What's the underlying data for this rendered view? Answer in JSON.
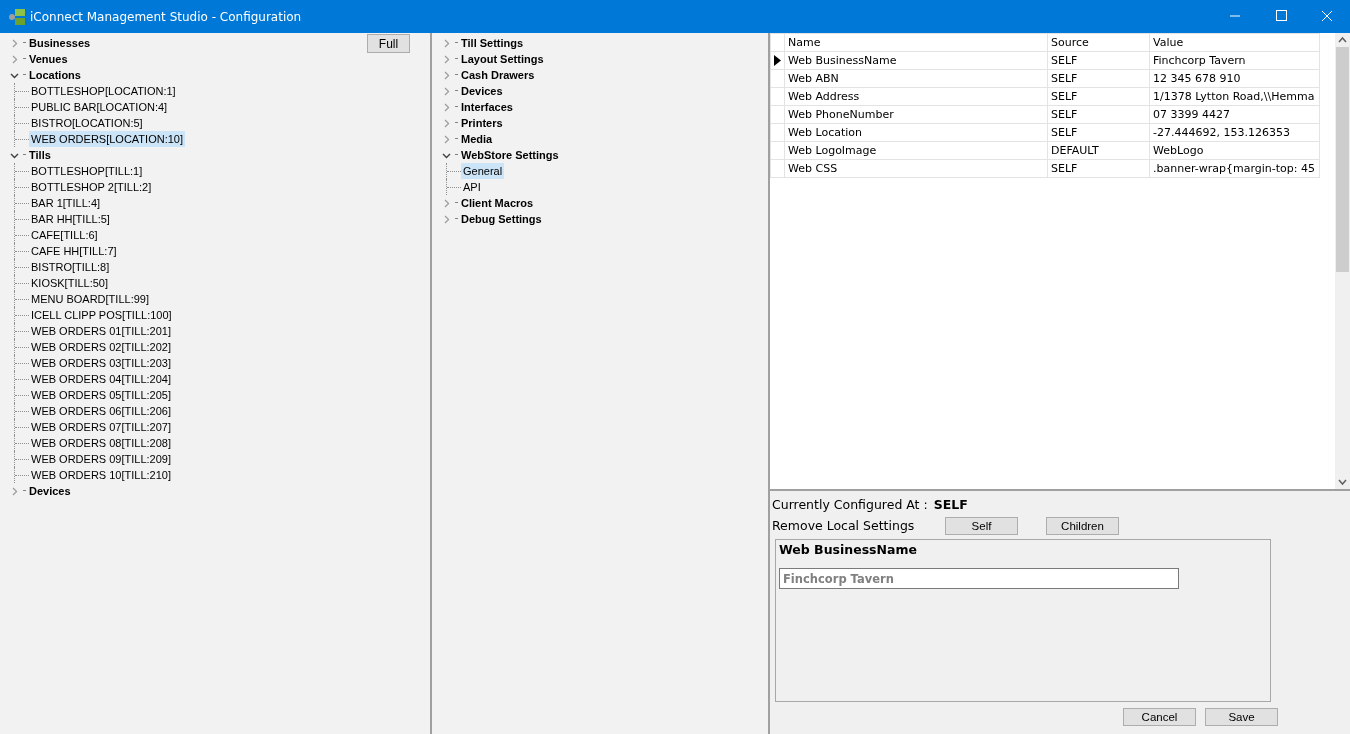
{
  "window": {
    "title": "iConnect Management Studio - Configuration"
  },
  "entity_tree": {
    "full_button": "Full",
    "items": [
      {
        "label": "Businesses",
        "expanded": false
      },
      {
        "label": "Venues",
        "expanded": false
      },
      {
        "label": "Locations",
        "expanded": true,
        "children": [
          {
            "label": "BOTTLESHOP[LOCATION:1]",
            "selected": false
          },
          {
            "label": "PUBLIC BAR[LOCATION:4]",
            "selected": false
          },
          {
            "label": "BISTRO[LOCATION:5]",
            "selected": false
          },
          {
            "label": "WEB ORDERS[LOCATION:10]",
            "selected": true
          }
        ]
      },
      {
        "label": "Tills",
        "expanded": true,
        "children": [
          {
            "label": "BOTTLESHOP[TILL:1]",
            "selected": false
          },
          {
            "label": "BOTTLESHOP 2[TILL:2]",
            "selected": false
          },
          {
            "label": "BAR 1[TILL:4]",
            "selected": false
          },
          {
            "label": "BAR HH[TILL:5]",
            "selected": false
          },
          {
            "label": "CAFE[TILL:6]",
            "selected": false
          },
          {
            "label": "CAFE HH[TILL:7]",
            "selected": false
          },
          {
            "label": "BISTRO[TILL:8]",
            "selected": false
          },
          {
            "label": "KIOSK[TILL:50]",
            "selected": false
          },
          {
            "label": "MENU BOARD[TILL:99]",
            "selected": false
          },
          {
            "label": "ICELL CLIPP POS[TILL:100]",
            "selected": false
          },
          {
            "label": "WEB ORDERS 01[TILL:201]",
            "selected": false
          },
          {
            "label": "WEB ORDERS 02[TILL:202]",
            "selected": false
          },
          {
            "label": "WEB ORDERS 03[TILL:203]",
            "selected": false
          },
          {
            "label": "WEB ORDERS 04[TILL:204]",
            "selected": false
          },
          {
            "label": "WEB ORDERS 05[TILL:205]",
            "selected": false
          },
          {
            "label": "WEB ORDERS 06[TILL:206]",
            "selected": false
          },
          {
            "label": "WEB ORDERS 07[TILL:207]",
            "selected": false
          },
          {
            "label": "WEB ORDERS 08[TILL:208]",
            "selected": false
          },
          {
            "label": "WEB ORDERS 09[TILL:209]",
            "selected": false
          },
          {
            "label": "WEB ORDERS 10[TILL:210]",
            "selected": false
          }
        ]
      },
      {
        "label": "Devices",
        "expanded": false
      }
    ]
  },
  "settings_tree": {
    "items": [
      {
        "label": "Till Settings",
        "expanded": false
      },
      {
        "label": "Layout Settings",
        "expanded": false
      },
      {
        "label": "Cash Drawers",
        "expanded": false
      },
      {
        "label": "Devices",
        "expanded": false
      },
      {
        "label": "Interfaces",
        "expanded": false
      },
      {
        "label": "Printers",
        "expanded": false
      },
      {
        "label": "Media",
        "expanded": false
      },
      {
        "label": "WebStore Settings",
        "expanded": true,
        "children": [
          {
            "label": "General",
            "selected": true
          },
          {
            "label": "API",
            "selected": false
          }
        ]
      },
      {
        "label": "Client Macros",
        "expanded": false
      },
      {
        "label": "Debug Settings",
        "expanded": false
      }
    ]
  },
  "table": {
    "columns": [
      "Name",
      "Source",
      "Value"
    ],
    "rows": [
      {
        "cells": [
          "Web BusinessName",
          "SELF",
          "Finchcorp Tavern"
        ],
        "selected": true
      },
      {
        "cells": [
          "Web ABN",
          "SELF",
          "12 345 678 910"
        ],
        "selected": false
      },
      {
        "cells": [
          "Web Address",
          "SELF",
          "1/1378 Lytton Road,\\\\Hemma"
        ],
        "selected": false
      },
      {
        "cells": [
          "Web PhoneNumber",
          "SELF",
          "07 3399 4427"
        ],
        "selected": false
      },
      {
        "cells": [
          "Web Location",
          "SELF",
          "-27.444692, 153.126353"
        ],
        "selected": false
      },
      {
        "cells": [
          "Web LogoImage",
          "DEFAULT",
          "WebLogo"
        ],
        "selected": false
      },
      {
        "cells": [
          "Web CSS",
          "SELF",
          ".banner-wrap{margin-top: 45"
        ],
        "selected": false
      }
    ]
  },
  "editor": {
    "configured_label": "Currently Configured At :",
    "configured_value": "SELF",
    "remove_label": "Remove Local Settings",
    "remove_buttons": [
      "Self",
      "Children"
    ],
    "setting_title": "Web BusinessName",
    "field": {
      "value": "Finchcorp Tavern",
      "disabled": true
    },
    "buttons": [
      "Cancel",
      "Save"
    ]
  }
}
